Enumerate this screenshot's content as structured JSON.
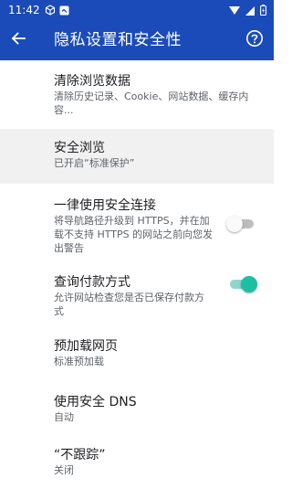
{
  "status_bar": {
    "time": "11:42",
    "left_icons": [
      "cube-icon",
      "app-notification-icon"
    ],
    "right_icons": [
      "wifi-icon",
      "cellular-signal-icon",
      "battery-icon"
    ]
  },
  "app_bar": {
    "title": "隐私设置和安全性",
    "back_icon": "arrow-back-icon",
    "help_icon": "help-icon"
  },
  "settings": [
    {
      "title": "清除浏览数据",
      "summary": "清除历史记录、Cookie、网站数据、缓存内容..."
    },
    {
      "title": "安全浏览",
      "summary": "已开启“标准保护”"
    },
    {
      "title": "一律使用安全连接",
      "summary": "将导航路径升级到 HTTPS，并在加载不支持 HTTPS 的网站之前向您发出警告",
      "toggle": false
    },
    {
      "title": "查询付款方式",
      "summary": "允许网站检查您是否已保存付款方式",
      "toggle": true
    },
    {
      "title": "预加载网页",
      "summary": "标准预加载"
    },
    {
      "title": "使用安全 DNS",
      "summary": "自动"
    },
    {
      "title": "“不跟踪”",
      "summary": "关闭"
    }
  ],
  "colors": {
    "primary": "#1a4bb8",
    "toggle_on": "#1dbfa4",
    "toggle_off": "#bdbdbd",
    "selected_bg": "#f1f1f1"
  }
}
